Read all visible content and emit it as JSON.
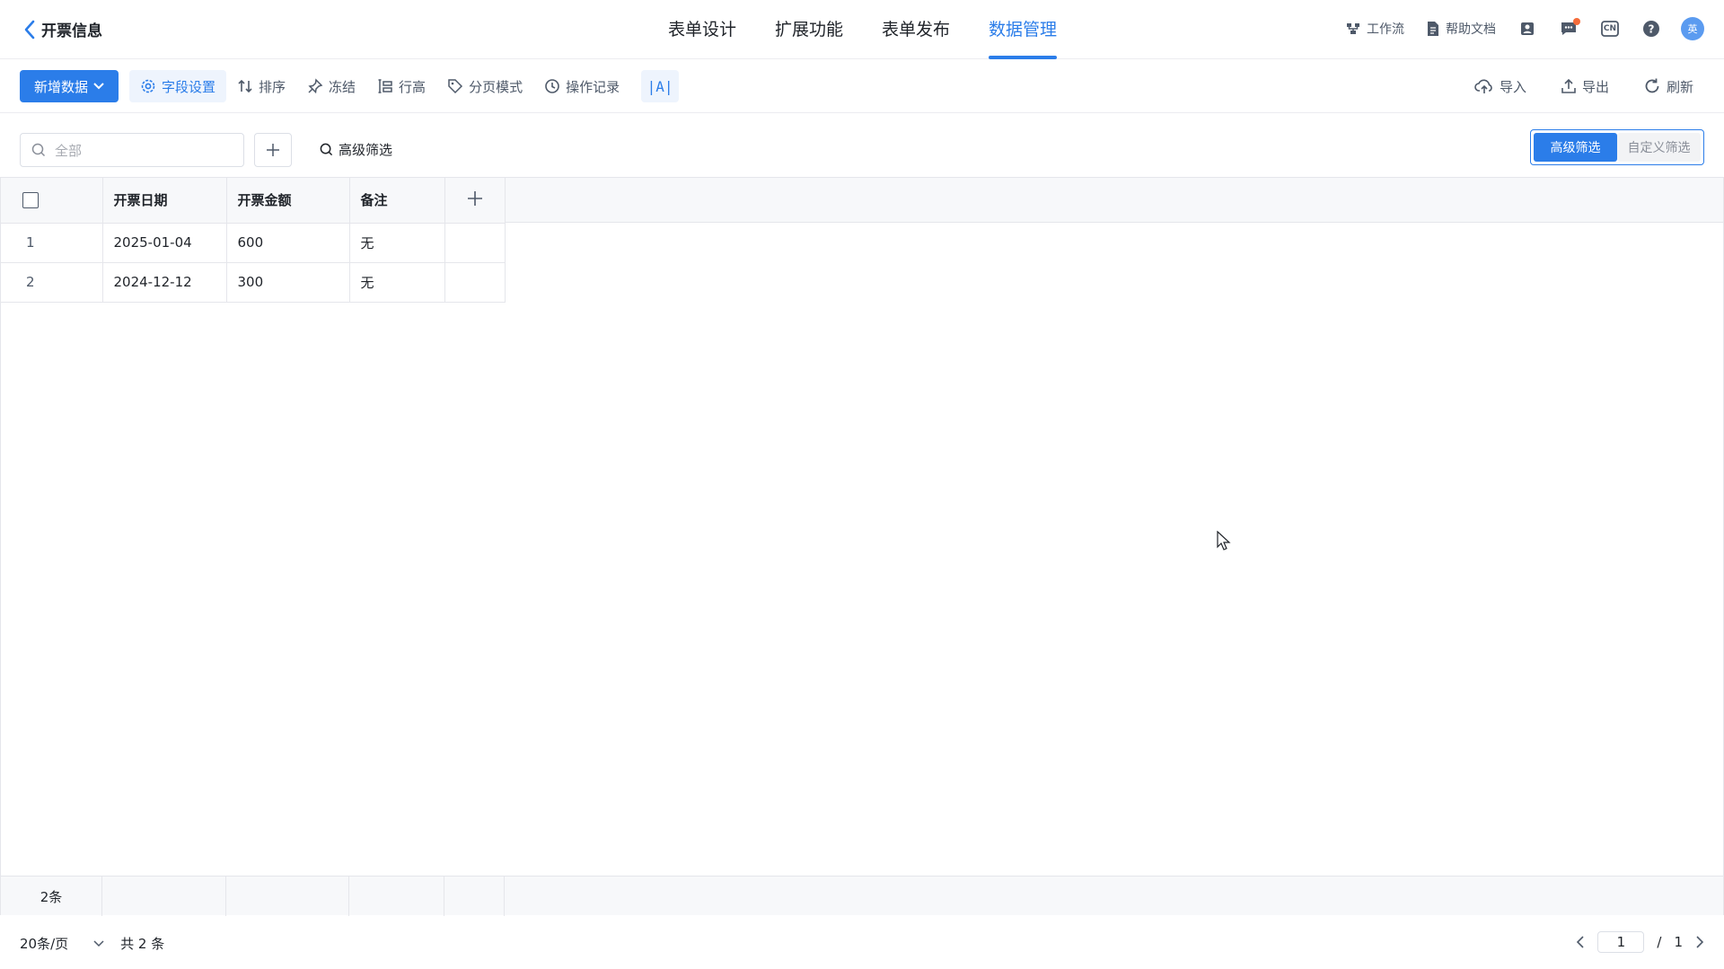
{
  "header": {
    "back_title": "开票信息",
    "tabs": [
      {
        "label": "表单设计"
      },
      {
        "label": "扩展功能"
      },
      {
        "label": "表单发布"
      },
      {
        "label": "数据管理",
        "active": true
      }
    ],
    "right": {
      "workflow_label": "工作流",
      "help_label": "帮助文档",
      "lang_label": "CN",
      "avatar_text": "英"
    }
  },
  "toolbar": {
    "new_data_label": "新增数据",
    "tools": [
      {
        "label": "字段设置",
        "icon": "gear-icon"
      },
      {
        "label": "排序",
        "icon": "sort-icon"
      },
      {
        "label": "冻结",
        "icon": "pin-icon"
      },
      {
        "label": "行高",
        "icon": "row-height-icon"
      },
      {
        "label": "分页模式",
        "icon": "tag-icon"
      },
      {
        "label": "操作记录",
        "icon": "clock-icon"
      }
    ],
    "text_mode_label": "|A|",
    "right_tools": [
      {
        "label": "导入",
        "icon": "cloud-upload-icon"
      },
      {
        "label": "导出",
        "icon": "export-icon"
      },
      {
        "label": "刷新",
        "icon": "refresh-icon"
      }
    ]
  },
  "filter": {
    "search_placeholder": "全部",
    "advanced_link": "高级筛选",
    "segment": {
      "on": "高级筛选",
      "off": "自定义筛选"
    }
  },
  "table": {
    "columns": [
      "开票日期",
      "开票金额",
      "备注"
    ],
    "rows": [
      {
        "index": "1",
        "date": "2025-01-04",
        "amount": "600",
        "note": "无"
      },
      {
        "index": "2",
        "date": "2024-12-12",
        "amount": "300",
        "note": "无"
      }
    ],
    "footer_count": "2条"
  },
  "pagination": {
    "page_size": "20条/页",
    "total": "共 2 条",
    "current_page": "1",
    "separator": "/",
    "total_pages": "1"
  },
  "colors": {
    "accent": "#2b7de9",
    "header_bg": "#f7f8fa",
    "border": "#e5e6eb"
  }
}
